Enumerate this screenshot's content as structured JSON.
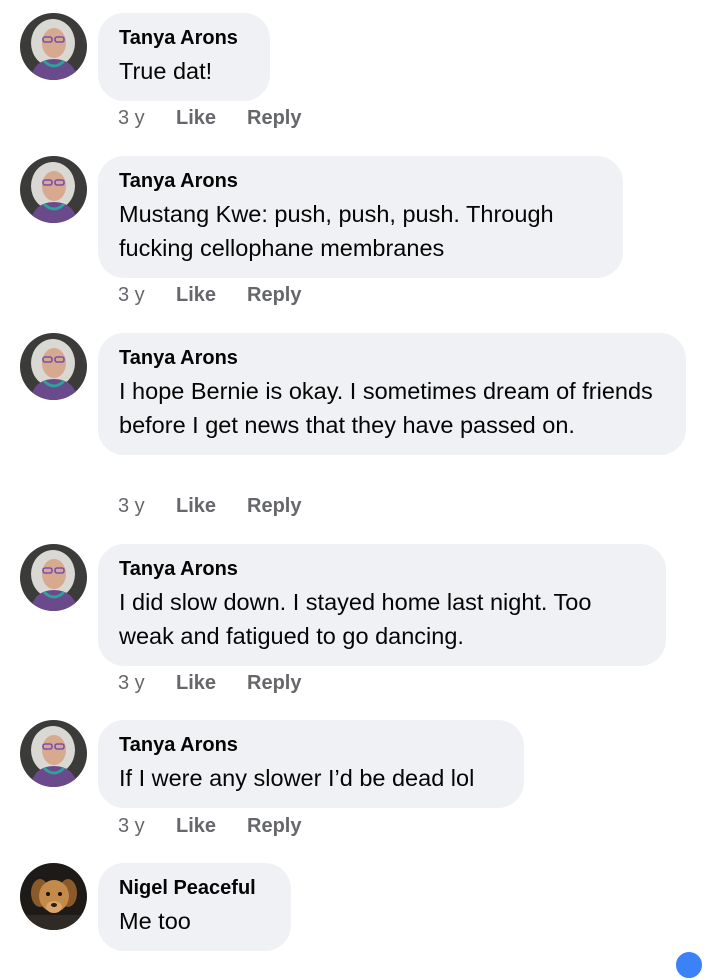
{
  "comments": [
    {
      "author": "Tanya Arons",
      "text": "True dat!",
      "time": "3 y",
      "like_label": "Like",
      "reply_label": "Reply",
      "avatar_icon": "woman-portrait-avatar"
    },
    {
      "author": "Tanya Arons",
      "text": "Mustang Kwe: push, push, push.  Through fucking cellophane membranes",
      "time": "3 y",
      "like_label": "Like",
      "reply_label": "Reply",
      "avatar_icon": "woman-portrait-avatar"
    },
    {
      "author": "Tanya Arons",
      "text": "I hope Bernie is okay.  I sometimes dream of friends before I get news that they have passed on.",
      "time": "3 y",
      "like_label": "Like",
      "reply_label": "Reply",
      "avatar_icon": "woman-portrait-avatar"
    },
    {
      "author": "Tanya Arons",
      "text": "I did slow down.  I stayed home last night. Too weak and fatigued to go dancing.",
      "time": "3 y",
      "like_label": "Like",
      "reply_label": "Reply",
      "avatar_icon": "woman-portrait-avatar"
    },
    {
      "author": "Tanya Arons",
      "text": "If I were any slower I’d be dead lol",
      "time": "3 y",
      "like_label": "Like",
      "reply_label": "Reply",
      "avatar_icon": "woman-portrait-avatar"
    },
    {
      "author": "Nigel Peaceful",
      "text": "Me too",
      "avatar_icon": "dog-avatar"
    }
  ],
  "colors": {
    "bubble_bg": "#f0f1f4",
    "text": "#050505",
    "meta_text": "#65676b",
    "reaction_blue": "#3b82f6"
  }
}
